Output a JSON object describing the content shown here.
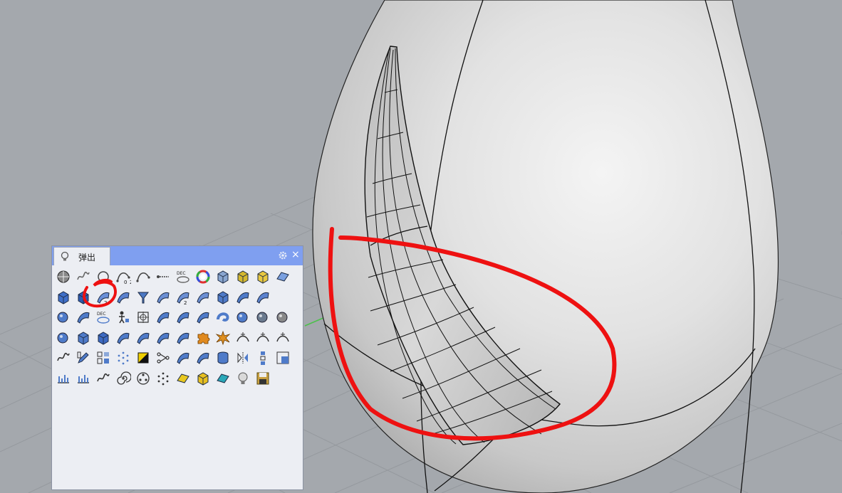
{
  "popup": {
    "tab_label": "弹出",
    "close_label": "×",
    "tools": [
      {
        "name": "render-sphere-icon",
        "icon": "sphere",
        "color": "#555555"
      },
      {
        "name": "dots-curve-icon",
        "icon": "squiggle",
        "color": "#666666"
      },
      {
        "name": "circle-icon",
        "icon": "circle",
        "color": "#444444"
      },
      {
        "name": "point-curve-icon",
        "icon": "curve",
        "color": "#444444",
        "label": "0_2"
      },
      {
        "name": "curve-tangent-icon",
        "icon": "curve",
        "color": "#444444"
      },
      {
        "name": "dimension-icon",
        "icon": "line",
        "color": "#444444"
      },
      {
        "name": "dec-surface-icon",
        "icon": "dec",
        "color": "#666666",
        "label": "DEC"
      },
      {
        "name": "color-wheel-icon",
        "icon": "wheel",
        "color": "#e04040"
      },
      {
        "name": "box-icon",
        "icon": "cube",
        "color": "#8aa6d0"
      },
      {
        "name": "extrude-icon",
        "icon": "cube",
        "color": "#d4b830"
      },
      {
        "name": "sun-box-icon",
        "icon": "cube",
        "color": "#e8c840"
      },
      {
        "name": "panel-icon",
        "icon": "panel",
        "color": "#7aa0e0"
      },
      {
        "name": "solid-box-icon",
        "icon": "cube",
        "color": "#3f6fc8"
      },
      {
        "name": "mesh-box-icon",
        "icon": "cube",
        "color": "#2d5bb0"
      },
      {
        "name": "blend-surface-icon",
        "icon": "surf",
        "color": "#6a90d8",
        "label": "2"
      },
      {
        "name": "revolve-icon",
        "icon": "surf",
        "color": "#5b82cf"
      },
      {
        "name": "funnel-icon",
        "icon": "funnel",
        "color": "#4c78c4"
      },
      {
        "name": "sweep-icon",
        "icon": "surf",
        "color": "#6b8fd4"
      },
      {
        "name": "sweep2-icon",
        "icon": "surf",
        "color": "#6b8fd4",
        "label": "2"
      },
      {
        "name": "loft-icon",
        "icon": "surf",
        "color": "#6b8fd4"
      },
      {
        "name": "cap-icon",
        "icon": "cube",
        "color": "#4f7bc9"
      },
      {
        "name": "network-surface-icon",
        "icon": "surf",
        "color": "#4f7bc9"
      },
      {
        "name": "fold-surface-icon",
        "icon": "surf",
        "color": "#5b82cf"
      },
      {
        "name": "spacer-a",
        "icon": "none",
        "color": "#ffffff"
      },
      {
        "name": "sphere-point-icon",
        "icon": "ball",
        "color": "#4f7bc9"
      },
      {
        "name": "bend-icon",
        "icon": "surf",
        "color": "#4f7bc9"
      },
      {
        "name": "dec-plane-icon",
        "icon": "dec",
        "color": "#4f7bc9",
        "label": "DEC"
      },
      {
        "name": "figure-icon",
        "icon": "figure",
        "color": "#333333"
      },
      {
        "name": "target-icon",
        "icon": "target",
        "color": "#333333"
      },
      {
        "name": "plane-normal-icon",
        "icon": "surf",
        "color": "#4f7bc9"
      },
      {
        "name": "plane-extrude-icon",
        "icon": "surf",
        "color": "#4f7bc9"
      },
      {
        "name": "hatch-plane-icon",
        "icon": "surf",
        "color": "#4f7bc9"
      },
      {
        "name": "pipe-icon",
        "icon": "pipe",
        "color": "#4f7bc9"
      },
      {
        "name": "sphere-union-icon",
        "icon": "ball",
        "color": "#4f7bc9"
      },
      {
        "name": "boolean-diff-icon",
        "icon": "ball",
        "color": "#6a7a8e"
      },
      {
        "name": "boolean-split-icon",
        "icon": "ball",
        "color": "#888888"
      },
      {
        "name": "sphere-cut-icon",
        "icon": "ball",
        "color": "#4f7bc9"
      },
      {
        "name": "box-edit-icon",
        "icon": "cube",
        "color": "#4f7bc9"
      },
      {
        "name": "box-mesh-icon",
        "icon": "cube",
        "color": "#3d6ac2"
      },
      {
        "name": "plane-align-icon",
        "icon": "surf",
        "color": "#4f7bc9"
      },
      {
        "name": "plane-rotate-icon",
        "icon": "surf",
        "color": "#4f7bc9"
      },
      {
        "name": "plane-flip-icon",
        "icon": "surf",
        "color": "#4f7bc9"
      },
      {
        "name": "plane-text-icon",
        "icon": "surf",
        "color": "#4f7bc9"
      },
      {
        "name": "puzzle-icon",
        "icon": "puzzle",
        "color": "#e08a20"
      },
      {
        "name": "explode-icon",
        "icon": "burst",
        "color": "#e09020"
      },
      {
        "name": "trim-curve-icon",
        "icon": "arc",
        "color": "#333333"
      },
      {
        "name": "arc-point-icon",
        "icon": "arc",
        "color": "#333333"
      },
      {
        "name": "arc-offset-icon",
        "icon": "arc",
        "color": "#333333"
      },
      {
        "name": "wave-point-icon",
        "icon": "squiggle",
        "color": "#333333"
      },
      {
        "name": "edit-pencil-icon",
        "icon": "pencil",
        "color": "#4f7bc9"
      },
      {
        "name": "align-grid-icon",
        "icon": "grid",
        "color": "#4f7bc9"
      },
      {
        "name": "dot-ring-icon",
        "icon": "dots",
        "color": "#4f7bc9"
      },
      {
        "name": "contrast-icon",
        "icon": "contrast",
        "color": "#111111"
      },
      {
        "name": "node-chain-icon",
        "icon": "nodes",
        "color": "#333333"
      },
      {
        "name": "split-surface-icon",
        "icon": "surf",
        "color": "#4f7bc9"
      },
      {
        "name": "shell-surface-icon",
        "icon": "surf",
        "color": "#4f7bc9"
      },
      {
        "name": "cylinder-icon",
        "icon": "cyl",
        "color": "#4f7bc9"
      },
      {
        "name": "mirror-icon",
        "icon": "mirror",
        "color": "#333333"
      },
      {
        "name": "stack-icon",
        "icon": "stack",
        "color": "#4f7bc9"
      },
      {
        "name": "corner-box-icon",
        "icon": "corner",
        "color": "#4f7bc9"
      },
      {
        "name": "layout-bars-icon",
        "icon": "bars",
        "color": "#4f7bc9"
      },
      {
        "name": "ruler-icon",
        "icon": "bars",
        "color": "#4f7bc9"
      },
      {
        "name": "spring-curve-icon",
        "icon": "squiggle",
        "color": "#333333"
      },
      {
        "name": "spiral-icon",
        "icon": "spiral",
        "color": "#333333"
      },
      {
        "name": "reel-icon",
        "icon": "reel",
        "color": "#333333"
      },
      {
        "name": "scatter-icon",
        "icon": "dots",
        "color": "#333333"
      },
      {
        "name": "yellow-plane-icon",
        "icon": "panel",
        "color": "#e8c820"
      },
      {
        "name": "yellow-box-icon",
        "icon": "cube",
        "color": "#e8c020"
      },
      {
        "name": "cyan-shape-icon",
        "icon": "panel",
        "color": "#2aa8b8"
      },
      {
        "name": "lightbulb-icon",
        "icon": "bulb",
        "color": "#7a7a7a"
      },
      {
        "name": "save-icon",
        "icon": "save",
        "color": "#c8a040"
      }
    ]
  }
}
